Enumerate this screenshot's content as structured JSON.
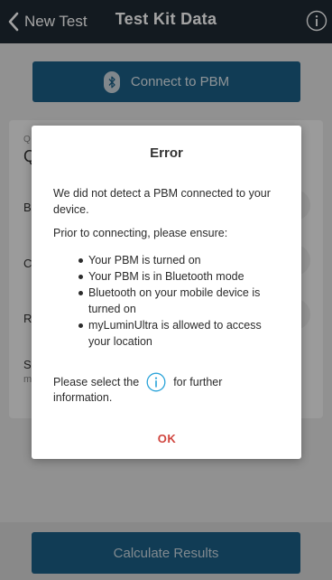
{
  "nav": {
    "back_label": "New Test",
    "title": "Test Kit Data"
  },
  "page": {
    "connect_button_label": "Connect to PBM",
    "card_caption": "Q",
    "card_value": "Q",
    "rows": [
      {
        "label": "B"
      },
      {
        "label": "C"
      },
      {
        "label": "R"
      },
      {
        "label": "S",
        "sub": "m"
      }
    ],
    "calculate_button_label": "Calculate Results"
  },
  "dialog": {
    "title": "Error",
    "message": "We did not detect a PBM connected to your device.",
    "prior_text": "Prior to connecting, please ensure:",
    "checklist": [
      "Your PBM is turned on",
      "Your PBM is in Bluetooth mode",
      "Bluetooth on your mobile device is turned on",
      "myLuminUltra is allowed to access your location"
    ],
    "note_before": "Please select the",
    "note_after": "for further",
    "note_line2": "information.",
    "ok_label": "OK"
  },
  "icons": {
    "back": "chevron-left-icon",
    "info": "info-icon",
    "bluetooth": "bluetooth-icon"
  },
  "colors": {
    "nav_bg": "#1f2a33",
    "primary_button": "#1b5f85",
    "ok_text": "#d0453e",
    "info_accent": "#29a3d9"
  }
}
